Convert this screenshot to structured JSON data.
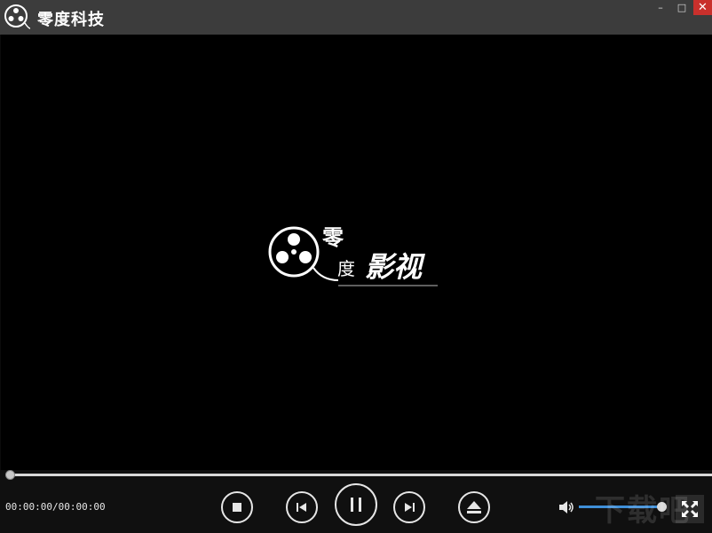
{
  "window": {
    "title": "零度科技",
    "minimize_icon": "minimize-icon",
    "maximize_icon": "maximize-icon",
    "close_icon": "close-icon",
    "min_glyph": "–",
    "max_glyph": "□",
    "close_glyph": "✕"
  },
  "brand": {
    "line1": "零",
    "line2": "度",
    "line3": "影视",
    "icon": "film-reel-icon"
  },
  "player": {
    "time": "00:00:00/00:00:00",
    "progress": 0,
    "volume": 1.0,
    "buttons": {
      "stop": "stop-icon",
      "previous": "previous-icon",
      "pause": "pause-icon",
      "next": "next-icon",
      "eject": "eject-icon",
      "volume": "speaker-icon",
      "fullscreen": "fullscreen-icon"
    }
  },
  "watermark": "下载吧",
  "colors": {
    "titlebar": "#3c3c3c",
    "close": "#c9302c",
    "accent": "#3f8fd8",
    "controls_bg": "#101010"
  }
}
